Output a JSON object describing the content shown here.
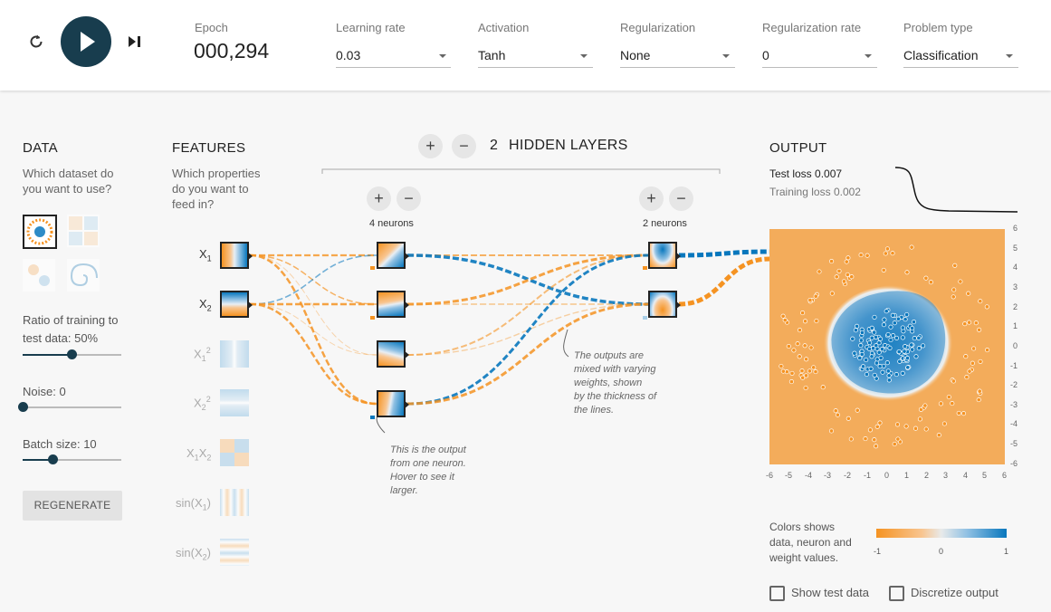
{
  "controls": {
    "epoch_label": "Epoch",
    "epoch_value": "000,294",
    "learning_rate_label": "Learning rate",
    "learning_rate_value": "0.03",
    "activation_label": "Activation",
    "activation_value": "Tanh",
    "regularization_label": "Regularization",
    "regularization_value": "None",
    "regularization_rate_label": "Regularization rate",
    "regularization_rate_value": "0",
    "problem_type_label": "Problem type",
    "problem_type_value": "Classification"
  },
  "data_panel": {
    "title": "DATA",
    "subtitle_line1": "Which dataset do",
    "subtitle_line2": "you want to use?",
    "ratio_label_line1": "Ratio of training to",
    "ratio_label_line2": "test data:  50%",
    "ratio_value": 50,
    "noise_label": "Noise:  0",
    "noise_value": 0,
    "batch_label": "Batch size:  10",
    "batch_value": 10,
    "regenerate_label": "REGENERATE"
  },
  "features_panel": {
    "title": "FEATURES",
    "subtitle_line1": "Which properties",
    "subtitle_line2": "do you want to",
    "subtitle_line3": "feed in?",
    "features": [
      "X1",
      "X2",
      "X1^2",
      "X2^2",
      "X1X2",
      "sin(X1)",
      "sin(X2)"
    ]
  },
  "network": {
    "hidden_layers_count": "2",
    "hidden_layers_label": "HIDDEN LAYERS",
    "layer1_neurons": "4 neurons",
    "layer2_neurons": "2 neurons",
    "annotation_neuron": [
      "This is the output",
      "from one neuron.",
      "Hover to see it",
      "larger."
    ],
    "annotation_weights": [
      "The outputs are",
      "mixed with varying",
      "weights, shown",
      "by the thickness of",
      "the lines."
    ]
  },
  "output_panel": {
    "title": "OUTPUT",
    "test_loss_label": "Test loss",
    "test_loss_value": "0.007",
    "training_loss_label": "Training loss",
    "training_loss_value": "0.002",
    "x_ticks": [
      "-6",
      "-5",
      "-4",
      "-3",
      "-2",
      "-1",
      "0",
      "1",
      "2",
      "3",
      "4",
      "5",
      "6"
    ],
    "y_ticks": [
      "6",
      "5",
      "4",
      "3",
      "2",
      "1",
      "0",
      "-1",
      "-2",
      "-3",
      "-4",
      "-5",
      "-6"
    ],
    "legend_text_line1": "Colors shows",
    "legend_text_line2": "data, neuron and",
    "legend_text_line3": "weight values.",
    "legend_min": "-1",
    "legend_mid": "0",
    "legend_max": "1",
    "show_test_data_label": "Show test data",
    "discretize_output_label": "Discretize output",
    "show_test_data_checked": false,
    "discretize_output_checked": false
  },
  "colors": {
    "orange": "#f59322",
    "blue": "#0877bd",
    "dark_button": "#183d4e"
  }
}
